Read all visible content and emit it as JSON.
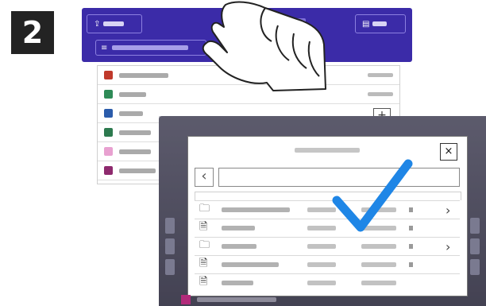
{
  "step": {
    "number": "2"
  },
  "header": {
    "left_icon": "upload-icon",
    "right_icon": "scan-icon",
    "search_icon": "filter-icon"
  },
  "file_list": {
    "items": [
      {
        "icon": "pdf-icon",
        "color": "#c0392b"
      },
      {
        "icon": "image-icon",
        "color": "#2e8b57"
      },
      {
        "icon": "doc-icon",
        "color": "#2b5cab"
      },
      {
        "icon": "sheet-icon",
        "color": "#2d7a4f"
      },
      {
        "icon": "file-icon",
        "color": "#e8a1d0"
      },
      {
        "icon": "folder-icon",
        "color": "#8e2a6e"
      }
    ],
    "add_label": "+"
  },
  "dialog": {
    "close_label": "×",
    "back_label": "‹",
    "rows": [
      {
        "icon": "folder-icon",
        "has_chevron": true
      },
      {
        "icon": "file-icon",
        "has_chevron": false
      },
      {
        "icon": "folder-icon",
        "has_chevron": true
      },
      {
        "icon": "file-icon",
        "has_chevron": false
      },
      {
        "icon": "file-icon",
        "has_chevron": false
      }
    ],
    "chevron_label": "›"
  },
  "colors": {
    "header": "#3b2ba8",
    "check": "#1f86e6",
    "device": "#5a586a"
  }
}
